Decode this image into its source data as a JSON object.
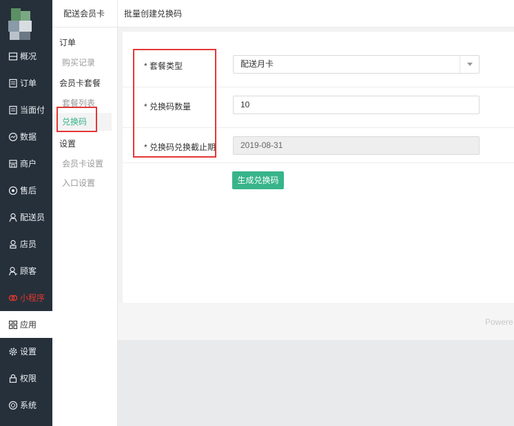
{
  "sidebar": {
    "items": [
      {
        "label": "概况",
        "icon": "overview-icon"
      },
      {
        "label": "订单",
        "icon": "order-icon"
      },
      {
        "label": "当面付",
        "icon": "face-pay-icon"
      },
      {
        "label": "数据",
        "icon": "data-icon"
      },
      {
        "label": "商户",
        "icon": "store-icon"
      },
      {
        "label": "售后",
        "icon": "after-sales-icon"
      },
      {
        "label": "配送员",
        "icon": "courier-icon"
      },
      {
        "label": "店员",
        "icon": "clerk-icon"
      },
      {
        "label": "顾客",
        "icon": "customer-icon"
      },
      {
        "label": "小程序",
        "icon": "mini-program-icon"
      },
      {
        "label": "应用",
        "icon": "apps-icon"
      },
      {
        "label": "设置",
        "icon": "gear-icon"
      },
      {
        "label": "权限",
        "icon": "lock-icon"
      },
      {
        "label": "系统",
        "icon": "system-icon"
      }
    ],
    "active_index": 10,
    "highlight_color": "#e5352b"
  },
  "submenu": {
    "title": "配送会员卡",
    "group_orders": "订单",
    "purchase_records": "购买记录",
    "group_packages": "会员卡套餐",
    "package_list": "套餐列表",
    "redeem_codes": "兑换码",
    "group_settings": "设置",
    "card_settings": "会员卡设置",
    "entry_settings": "入口设置"
  },
  "header": {
    "title": "批量创建兑换码"
  },
  "form": {
    "package_type_label": "* 套餐类型",
    "package_type_value": "配送月卡",
    "quantity_label": "* 兑换码数量",
    "quantity_value": "10",
    "deadline_label": "* 兑换码兑换截止期",
    "deadline_value": "2019-08-31",
    "submit_label": "生成兑换码"
  },
  "footer": {
    "powered": "Powere"
  },
  "colors": {
    "accent": "#38b48b",
    "sidebar_bg": "#26303b",
    "annotation": "#e53535"
  }
}
